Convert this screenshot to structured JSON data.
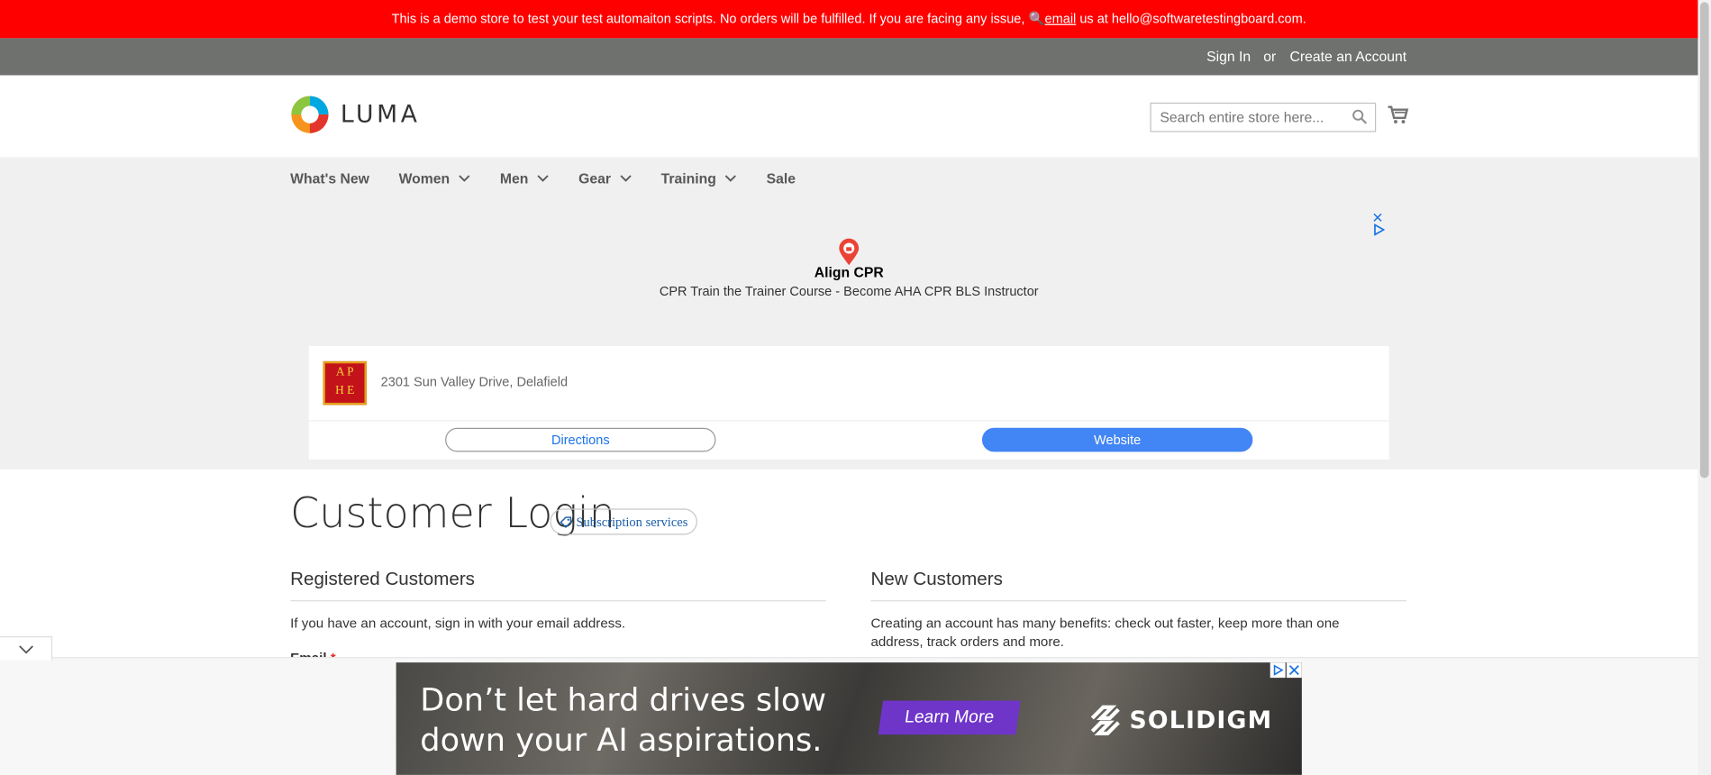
{
  "demo_notice": {
    "text_before": "This is a demo store to test your test automaiton scripts. No orders will be fulfilled. If you are facing any issue, ",
    "email_link": "email",
    "text_after": " us at hello@softwaretestingboard.com."
  },
  "header": {
    "sign_in": "Sign In",
    "or": "or",
    "create_account": "Create an Account"
  },
  "logo": {
    "text": "LUMA"
  },
  "search": {
    "placeholder": "Search entire store here..."
  },
  "nav": {
    "items": [
      {
        "label": "What's New",
        "has_dropdown": false
      },
      {
        "label": "Women",
        "has_dropdown": true
      },
      {
        "label": "Men",
        "has_dropdown": true
      },
      {
        "label": "Gear",
        "has_dropdown": true
      },
      {
        "label": "Training",
        "has_dropdown": true
      },
      {
        "label": "Sale",
        "has_dropdown": false
      }
    ]
  },
  "ad_top": {
    "title": "Align CPR",
    "subtitle": "CPR Train the Trainer Course - Become AHA CPR BLS Instructor",
    "address": "2301 Sun Valley Drive, Delafield",
    "logo_text_line1": "A P",
    "logo_text_line2": "H E",
    "directions": "Directions",
    "website": "Website"
  },
  "page": {
    "title": "Customer Login",
    "subscription_badge": "Subscription services"
  },
  "registered": {
    "title": "Registered Customers",
    "text": "If you have an account, sign in with your email address.",
    "email_label": "Email",
    "required_mark": "*"
  },
  "new_customers": {
    "title": "New Customers",
    "text": "Creating an account has many benefits: check out faster, keep more than one address, track orders and more."
  },
  "bottom_ad": {
    "line1": "Don’t let hard drives slow",
    "line2": "down your AI aspirations.",
    "cta": "Learn More",
    "brand": "SOLIDIGM"
  },
  "colors": {
    "demo_bar": "#ff0000",
    "header_panel": "#6e716e",
    "nav_bg": "#f0f0f0",
    "ad_button": "#4285f4",
    "banner_cta": "#6f35c9"
  }
}
